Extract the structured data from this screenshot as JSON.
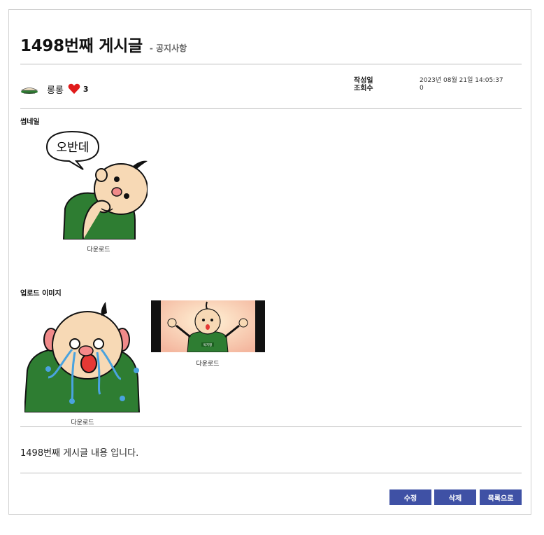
{
  "post": {
    "title": "1498번째 게시글",
    "category": "- 공지사항",
    "author": "롱롱",
    "likes": "3",
    "meta_labels": {
      "written": "작성일",
      "views": "조회수"
    },
    "meta_values": {
      "written": "2023년 08월 21일 14:05:37",
      "views": "0"
    },
    "body": "1498번째 게시글 내용 입니다."
  },
  "thumbnail": {
    "label": "썸네일",
    "bubble_text": "오반데",
    "download": "다운로드"
  },
  "uploads": {
    "label": "업로드 이미지",
    "items": [
      {
        "download": "다운로드"
      },
      {
        "download": "다운로드",
        "badge": "박지평"
      }
    ]
  },
  "buttons": {
    "edit": "수정",
    "delete": "삭제",
    "list": "목록으로"
  },
  "colors": {
    "button": "#3f51a5",
    "heart": "#e01b1b",
    "shirt": "#2e7d32",
    "skin": "#f7d9b5"
  },
  "icons": {
    "avatar": "bowl-avatar-icon",
    "heart": "heart-icon"
  }
}
